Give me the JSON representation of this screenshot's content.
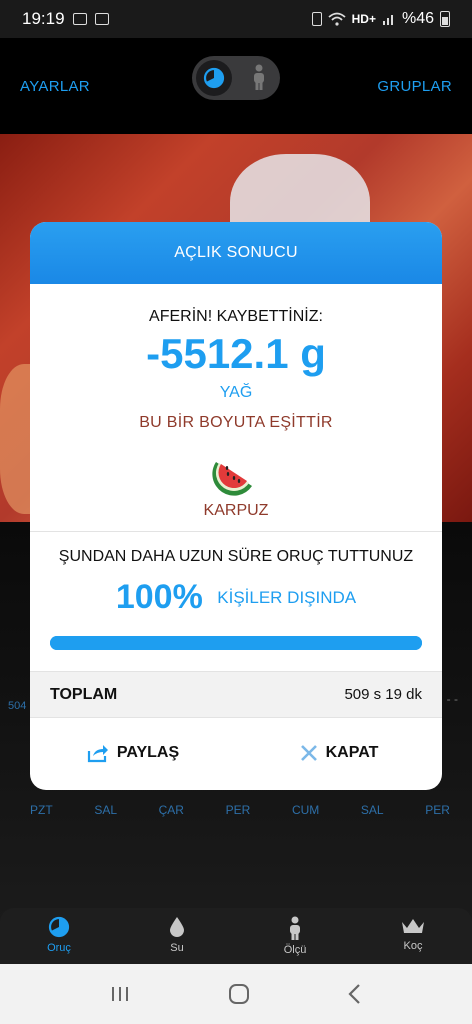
{
  "status_bar": {
    "time": "19:19",
    "battery": "%46",
    "network": "HD+"
  },
  "appbar": {
    "left_link": "AYARLAR",
    "right_link": "GRUPLAR"
  },
  "background": {
    "side_label": "504",
    "side_dash": "- -"
  },
  "weekdays": [
    "PZT",
    "SAL",
    "ÇAR",
    "PER",
    "CUM",
    "SAL",
    "PER"
  ],
  "modal": {
    "title": "AÇLIK SONUCU",
    "congrats": "AFERİN! KAYBETTİNİZ:",
    "amount": "-5512.1 g",
    "unit": "YAĞ",
    "equals": "BU BİR BOYUTA EŞİTTİR",
    "fruit_icon": "watermelon-icon",
    "fruit_name": "KARPUZ",
    "longer_than": "ŞUNDAN DAHA UZUN SÜRE ORUÇ TUTTUNUZ",
    "percent": "100%",
    "percent_label": "KİŞİLER DIŞINDA",
    "progress_fraction": 1.0,
    "total_label": "TOPLAM",
    "total_value": "509 s 19 dk",
    "share_label": "PAYLAŞ",
    "close_label": "KAPAT"
  },
  "tabs": [
    {
      "label": "Oruç",
      "icon": "fasting-icon",
      "active": true
    },
    {
      "label": "Su",
      "icon": "water-drop-icon",
      "active": false
    },
    {
      "label": "Ölçü",
      "icon": "person-icon",
      "active": false
    },
    {
      "label": "Koç",
      "icon": "crown-icon",
      "active": false
    }
  ],
  "colors": {
    "accent": "#1e9ef0",
    "fruit_text": "#8f3a2b",
    "header": "#1a88e6"
  }
}
